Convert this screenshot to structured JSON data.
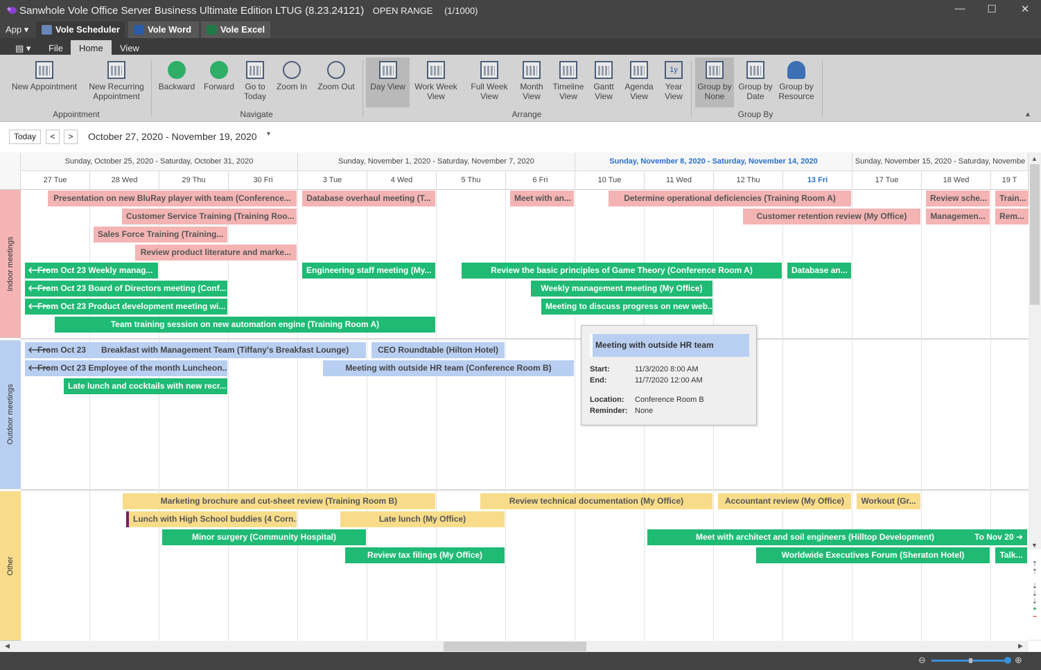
{
  "window": {
    "title": "Sanwhole Vole Office Server Business Ultimate Edition LTUG (8.23.24121)",
    "mode": "OPEN RANGE",
    "count": "(1/1000)",
    "minimize": "—",
    "maximize": "☐",
    "close": "✕"
  },
  "app_bar": {
    "menu": "App ▾",
    "tabs": [
      {
        "label": "Vole Scheduler",
        "color": "#4d6fae"
      },
      {
        "label": "Vole Word",
        "color": "#2b5cab"
      },
      {
        "label": "Vole Excel",
        "color": "#1f7a45"
      }
    ]
  },
  "ribbon_tabs": {
    "quick": "▤ ▾",
    "items": [
      "File",
      "Home",
      "View"
    ],
    "active": "Home"
  },
  "ribbon": {
    "buttons": {
      "new_appointment": "New Appointment",
      "new_recurring": "New Recurring Appointment",
      "backward": "Backward",
      "forward": "Forward",
      "go_today": "Go to Today",
      "zoom_in": "Zoom In",
      "zoom_out": "Zoom Out",
      "day_view": "Day View",
      "work_week": "Work Week View",
      "full_week": "Full Week View",
      "month_view": "Month View",
      "timeline_view": "Timeline View",
      "gantt_view": "Gantt View",
      "agenda_view": "Agenda View",
      "year_view": "Year View",
      "year_icon": "1y",
      "group_none": "Group by None",
      "group_date": "Group by Date",
      "group_resource": "Group by Resource"
    },
    "groups": {
      "appointment": "Appointment",
      "navigate": "Navigate",
      "arrange": "Arrange",
      "group_by": "Group By"
    },
    "collapse": "▴"
  },
  "navbar": {
    "today": "Today",
    "prev": "<",
    "next": ">",
    "range": "October 27, 2020 - November 19, 2020",
    "caret": "▾"
  },
  "weeks": [
    "Sunday, October 25, 2020 - Saturday, October 31, 2020",
    "Sunday, November 1, 2020 - Saturday, November 7, 2020",
    "Sunday, November 8, 2020 - Saturday, November 14, 2020",
    "Sunday, November 15, 2020 - Saturday, Novembe"
  ],
  "days": [
    "27 Tue",
    "28 Wed",
    "29 Thu",
    "30 Fri",
    "3 Tue",
    "4 Wed",
    "5 Thu",
    "6 Fri",
    "10 Tue",
    "11 Wed",
    "12 Thu",
    "13 Fri",
    "17 Tue",
    "18 Wed",
    "19 T"
  ],
  "resources": {
    "indoor": "Indoor meetings",
    "outdoor": "Outdoor meetings",
    "other": "Other"
  },
  "appointments": {
    "indoor": [
      "Presentation on new BluRay player with team (Conference...",
      "Database overhaul meeting (T...",
      "Meet with an...",
      "Determine operational deficiencies (Training Room A)",
      "Review sche...",
      "Train...",
      "Customer Service Training (Training Roo...",
      "Customer retention review (My Office)",
      "Managemen...",
      "Rem...",
      "Sales Force Training (Training...",
      "Review product literature and marke...",
      "From Oct 23  Weekly manag...",
      "Engineering staff meeting (My...",
      "Review the basic principles of Game Theory (Conference Room A)",
      "Database an...",
      "From Oct 23 Board of Directors meeting (Conf...",
      "Weekly management meeting (My Office)",
      "From Oct 23 Product development meeting wi...",
      "Meeting to discuss progress on new web...",
      "Team training session on new automation engine (Training Room A)"
    ],
    "outdoor": {
      "from_oct23_a": "From Oct 23",
      "breakfast": "Breakfast with Management Team (Tiffany's Breakfast Lounge)",
      "ceo": "CEO Roundtable (Hilton Hotel)",
      "employee": "From Oct 23 Employee of the month Luncheon...",
      "hr": "Meeting with outside HR team (Conference Room B)",
      "late_lunch": "Late lunch and cocktails with new recr..."
    },
    "other": [
      "Marketing brochure and cut-sheet review (Training Room B)",
      "Review technical documentation (My Office)",
      "Accountant review (My Office)",
      "Workout (Gr...",
      "Lunch with High School buddies (4 Corn...",
      "Late lunch (My Office)",
      "Minor surgery (Community Hospital)",
      "Meet with architect and soil engineers (Hilltop Development)",
      "To Nov 20 ➜",
      "Review tax filings (My Office)",
      "Worldwide Executives Forum (Sheraton Hotel)",
      "Talk..."
    ]
  },
  "tooltip": {
    "title": "Meeting with outside HR team",
    "start_label": "Start:",
    "start": "11/3/2020   8:00 AM",
    "end_label": "End:",
    "end": "11/7/2020   12:00 AM",
    "location_label": "Location:",
    "location": "Conference Room B",
    "reminder_label": "Reminder:",
    "reminder": "None"
  },
  "arrow_left": "🡐",
  "scroll": {
    "up": "▲",
    "down": "▼",
    "left": "◀",
    "right": "▶"
  },
  "side_controls": [
    "⇡",
    "⇡",
    "⇣",
    "⇣",
    "⇣",
    "+",
    "−"
  ],
  "status": {
    "zoom_minus": "⊖",
    "zoom_plus": "⊕",
    "zoom_level": 0.98
  }
}
